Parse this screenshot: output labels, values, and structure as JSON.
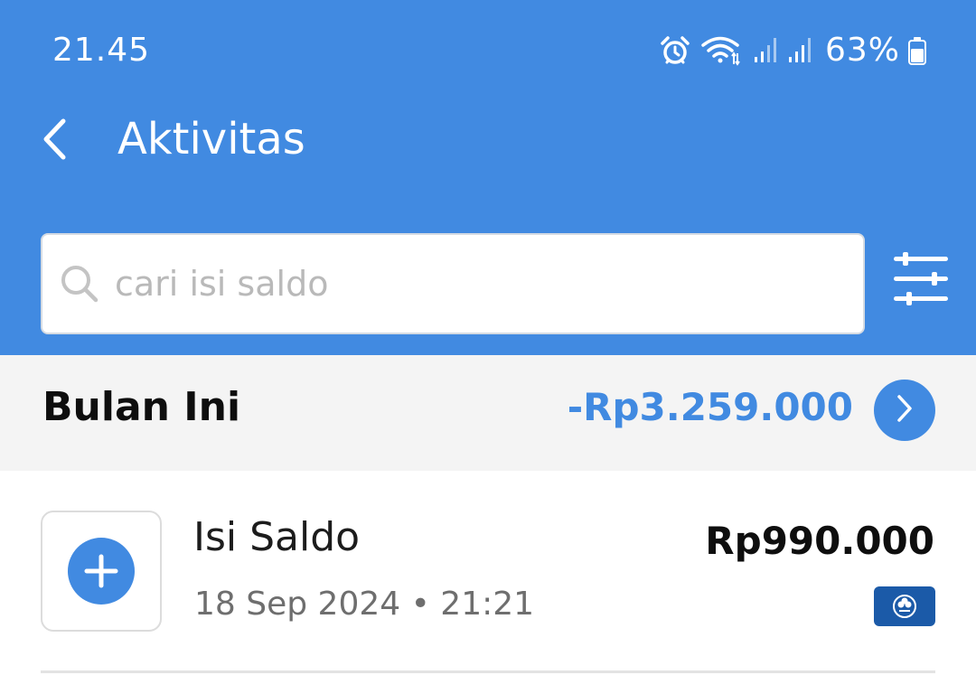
{
  "status_bar": {
    "time": "21.45",
    "battery_percent": "63%",
    "icons": [
      "alarm-icon",
      "wifi-icon",
      "signal-icon",
      "signal-icon",
      "battery-icon"
    ]
  },
  "header": {
    "back_icon": "chevron-left-icon",
    "title": "Aktivitas"
  },
  "search": {
    "icon": "search-icon",
    "placeholder": "cari isi saldo",
    "value": "",
    "filter_icon": "sliders-icon"
  },
  "summary": {
    "label": "Bulan Ini",
    "total": "-Rp3.259.000",
    "next_icon": "chevron-right-icon"
  },
  "transactions": [
    {
      "icon": "plus-icon",
      "title": "Isi Saldo",
      "date": "18 Sep 2024 • 21:21",
      "amount": "Rp990.000",
      "bank_icon": "bank-logo-icon"
    }
  ],
  "colors": {
    "primary": "#418ae1",
    "summary_bg": "#f4f4f4",
    "text_dark": "#0e0e0e",
    "text_muted": "#6e6e6e",
    "bank_logo": "#1b5aa8"
  }
}
